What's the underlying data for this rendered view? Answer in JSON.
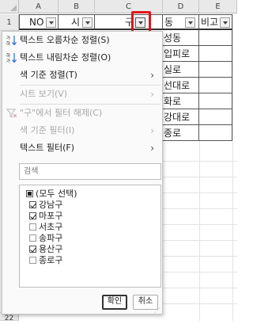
{
  "columns": [
    "A",
    "B",
    "C",
    "D",
    "E"
  ],
  "row_numbers": [
    "1",
    "22"
  ],
  "header_cells": {
    "no": "NO",
    "si": "시",
    "gu": "구",
    "dong": "동",
    "bigo": "비고"
  },
  "visible_column_d_cells": [
    "성동",
    "입피로",
    "실로",
    "선대로",
    "화로",
    "강대로",
    "종로"
  ],
  "menu": {
    "sort_asc": "텍스트 오름차순 정렬(S)",
    "sort_desc": "텍스트 내림차순 정렬(O)",
    "sort_by_color": "색 기준 정렬(T)",
    "sheet_view": "시트 보기(V)",
    "clear_filter": "\"구\"에서 필터 해제(C)",
    "filter_by_color": "색 기준 필터(I)",
    "text_filter": "텍스트 필터(F)",
    "search_placeholder": "검색"
  },
  "filter_items": [
    {
      "label": "(모두 선택)",
      "state": "mixed"
    },
    {
      "label": "강남구",
      "state": "checked"
    },
    {
      "label": "마포구",
      "state": "checked"
    },
    {
      "label": "서초구",
      "state": "unchecked"
    },
    {
      "label": "송파구",
      "state": "unchecked"
    },
    {
      "label": "용산구",
      "state": "checked"
    },
    {
      "label": "종로구",
      "state": "unchecked"
    }
  ],
  "buttons": {
    "ok": "확인",
    "cancel": "취소"
  },
  "colors": {
    "highlight_box": "#e0141c",
    "header_bg": "#e9e9e9"
  }
}
